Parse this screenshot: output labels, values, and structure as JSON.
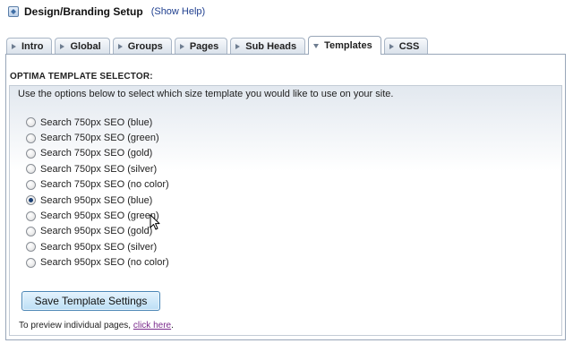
{
  "header": {
    "title": "Design/Branding Setup",
    "help_link": "(Show Help)",
    "icon": "settings-page-icon"
  },
  "tabs": [
    {
      "label": "Intro",
      "active": false
    },
    {
      "label": "Global",
      "active": false
    },
    {
      "label": "Groups",
      "active": false
    },
    {
      "label": "Pages",
      "active": false
    },
    {
      "label": "Sub Heads",
      "active": false
    },
    {
      "label": "Templates",
      "active": true
    },
    {
      "label": "CSS",
      "active": false
    }
  ],
  "selector": {
    "title": "OPTIMA TEMPLATE SELECTOR:",
    "intro": "Use the options below to select which size template you would like to use on your site.",
    "options": [
      {
        "label": "Search 750px SEO (blue)",
        "checked": false
      },
      {
        "label": "Search 750px SEO (green)",
        "checked": false
      },
      {
        "label": "Search 750px SEO (gold)",
        "checked": false
      },
      {
        "label": "Search 750px SEO (silver)",
        "checked": false
      },
      {
        "label": "Search 750px SEO (no color)",
        "checked": false
      },
      {
        "label": "Search 950px SEO (blue)",
        "checked": true
      },
      {
        "label": "Search 950px SEO (green)",
        "checked": false
      },
      {
        "label": "Search 950px SEO (gold)",
        "checked": false
      },
      {
        "label": "Search 950px SEO (silver)",
        "checked": false
      },
      {
        "label": "Search 950px SEO (no color)",
        "checked": false
      }
    ],
    "save_button": "Save Template Settings",
    "preview_text": "To preview individual pages,",
    "preview_link": "click here",
    "preview_end": "."
  },
  "colors": {
    "tab_border": "#98a6b8",
    "button_border": "#4a86b5",
    "link": "#1f3f8f",
    "visited_link": "#7a2a8c"
  }
}
